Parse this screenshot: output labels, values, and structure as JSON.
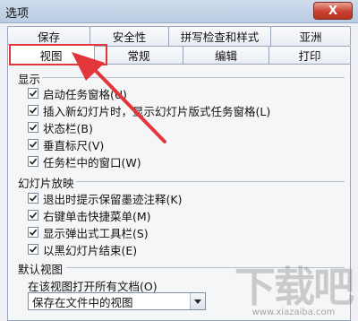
{
  "window": {
    "title": "选项",
    "close_label": "X"
  },
  "tabs": {
    "back_row": [
      "保存",
      "安全性",
      "拼写检查和样式",
      "亚洲"
    ],
    "front_row": [
      "视图",
      "常规",
      "编辑",
      "打印"
    ],
    "selected": "视图"
  },
  "sections": {
    "display": {
      "title": "显示",
      "options": [
        {
          "label": "启动任务窗格(U)",
          "checked": true
        },
        {
          "label": "插入新幻灯片时，显示幻灯片版式任务窗格(L)",
          "checked": true
        },
        {
          "label": "状态栏(B)",
          "checked": true
        },
        {
          "label": "垂直标尺(V)",
          "checked": true
        },
        {
          "label": "任务栏中的窗口(W)",
          "checked": true
        }
      ]
    },
    "slideshow": {
      "title": "幻灯片放映",
      "options": [
        {
          "label": "退出时提示保留墨迹注释(K)",
          "checked": true
        },
        {
          "label": "右键单击快捷菜单(M)",
          "checked": true
        },
        {
          "label": "显示弹出式工具栏(S)",
          "checked": true
        },
        {
          "label": "以黑幻灯片结束(E)",
          "checked": true
        }
      ]
    },
    "default_view": {
      "title": "默认视图",
      "combo_label": "在该视图打开所有文档(O)",
      "combo_value": "保存在文件中的视图"
    }
  },
  "annotation": {
    "color": "#e2363a"
  },
  "watermark": {
    "logo": "下载吧",
    "domain": "www.xiazaiba.com"
  }
}
